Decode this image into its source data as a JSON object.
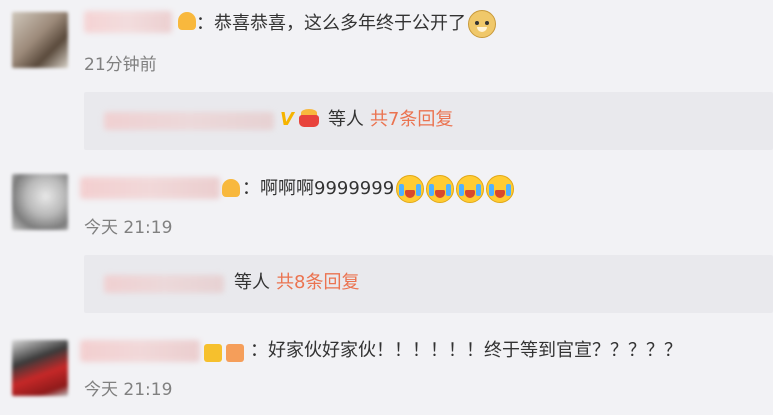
{
  "comments": [
    {
      "text": "：恭喜恭喜，这么多年终于公开了",
      "timestamp": "21分钟前",
      "emoji": "doge-icon",
      "reply": {
        "suffix": "等人",
        "count": "共7条回复"
      }
    },
    {
      "text": "：啊啊啊9999999",
      "timestamp": "今天 21:19",
      "emoji": "crying-face-icon",
      "reply": {
        "suffix": "等人",
        "count": "共8条回复"
      }
    },
    {
      "text": "：好家伙好家伙！！！！！！终于等到官宣？？？？？",
      "timestamp": "今天 21:19"
    }
  ],
  "colors": {
    "background": "#f2f2f5",
    "reply_box": "#e9e9ed",
    "link": "#eb7350",
    "timestamp": "#808080",
    "text": "#333333"
  }
}
